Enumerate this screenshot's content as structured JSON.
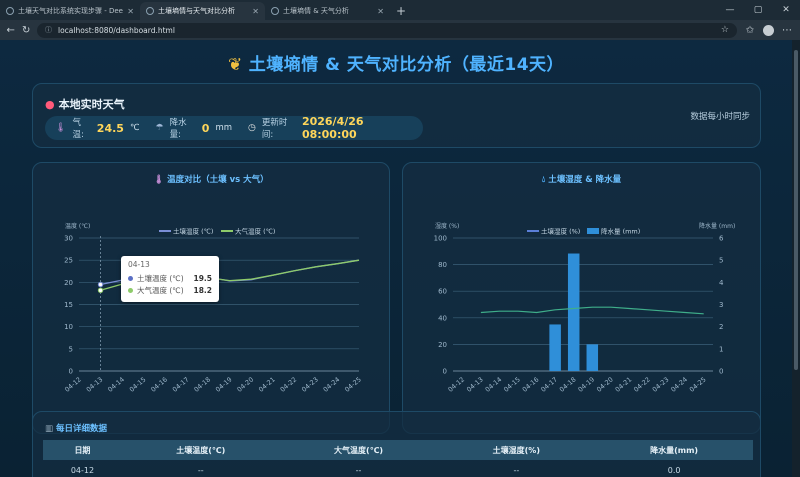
{
  "browser": {
    "tabs": [
      {
        "label": "土壤天气对比系统实现步骤 - Dee",
        "active": false
      },
      {
        "label": "土壤墒情与天气对比分析",
        "active": true
      },
      {
        "label": "土壤墒情 & 天气分析",
        "active": false
      }
    ],
    "url": "localhost:8080/dashboard.html"
  },
  "page": {
    "title": "土壤墒情 & 天气对比分析（最近14天）"
  },
  "weather": {
    "title": "本地实时天气",
    "temp_label": "气温:",
    "temp_value": "24.5",
    "temp_unit": "℃",
    "rain_label": "降水量:",
    "rain_value": "0",
    "rain_unit": "mm",
    "time_label": "更新时间:",
    "time_value": "2026/4/26 08:00:00",
    "sync_note": "数据每小时同步"
  },
  "colors": {
    "soil_temp": "#7b8fd6",
    "air_temp": "#8ecb6a",
    "soil_humidity": "#5b7fd8",
    "humidity_line": "#3fae8a",
    "rain_bar": "#2f8fd9",
    "accent": "#4fb3ff"
  },
  "chart_data": [
    {
      "type": "line",
      "title": "温度对比（土壤 vs 大气）",
      "ylabel": "温度 (℃)",
      "x": [
        "04-12",
        "04-13",
        "04-14",
        "04-15",
        "04-16",
        "04-17",
        "04-18",
        "04-19",
        "04-20",
        "04-21",
        "04-22",
        "04-23",
        "04-24",
        "04-25"
      ],
      "ylim": [
        0,
        30
      ],
      "yticks": [
        0,
        5,
        10,
        15,
        20,
        25,
        30
      ],
      "series": [
        {
          "name": "土壤温度 (℃)",
          "values": [
            null,
            19.5,
            20.5,
            21.8,
            22.8,
            22.3,
            21.2,
            20.3,
            20.6,
            21.6,
            22.6,
            23.5,
            24.2,
            25.0
          ]
        },
        {
          "name": "大气温度 (℃)",
          "values": [
            null,
            18.2,
            19.6,
            20.4,
            22.3,
            22.3,
            21.0,
            20.4,
            20.7,
            21.6,
            22.6,
            23.5,
            24.2,
            25.0
          ]
        }
      ],
      "tooltip": {
        "x": "04-13",
        "rows": [
          {
            "name": "土壤温度 (℃)",
            "value": "19.5"
          },
          {
            "name": "大气温度 (℃)",
            "value": "18.2"
          }
        ]
      }
    },
    {
      "type": "bar",
      "title": "土壤湿度 & 降水量",
      "ylabel": "湿度 (%)",
      "y2label": "降水量 (mm)",
      "x": [
        "04-12",
        "04-13",
        "04-14",
        "04-15",
        "04-16",
        "04-17",
        "04-18",
        "04-19",
        "04-20",
        "04-21",
        "04-22",
        "04-23",
        "04-24",
        "04-25"
      ],
      "ylim": [
        0,
        100
      ],
      "yticks": [
        0,
        20,
        40,
        60,
        80,
        100
      ],
      "y2lim": [
        0,
        6
      ],
      "y2ticks": [
        0,
        1,
        2,
        3,
        4,
        5,
        6
      ],
      "series": [
        {
          "name": "土壤湿度 (%)",
          "kind": "line",
          "values": [
            null,
            44,
            45,
            45,
            44,
            46,
            47,
            48,
            48,
            47,
            46,
            45,
            44,
            43
          ]
        },
        {
          "name": "降水量 (mm)",
          "kind": "bar",
          "axis": "y2",
          "values": [
            0,
            0,
            0,
            0,
            0,
            2.1,
            5.3,
            1.2,
            0,
            0,
            0,
            0,
            0,
            0
          ]
        }
      ]
    }
  ],
  "table": {
    "title": "每日详细数据",
    "headers": [
      "日期",
      "土壤温度(℃)",
      "大气温度(℃)",
      "土壤湿度(%)",
      "降水量(mm)"
    ],
    "rows": [
      [
        "04-12",
        "--",
        "--",
        "--",
        "0.0"
      ]
    ]
  }
}
